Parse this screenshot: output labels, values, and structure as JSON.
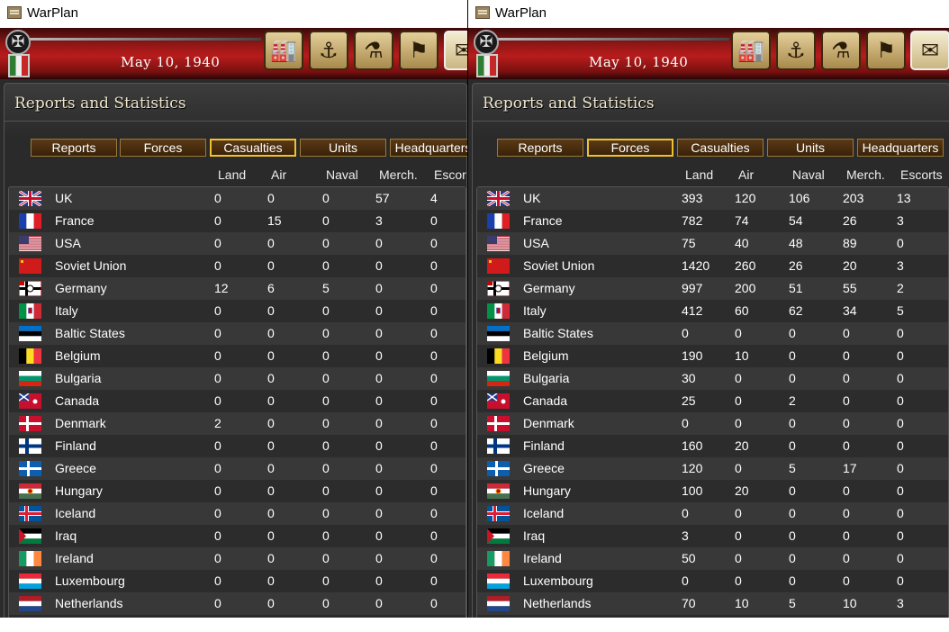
{
  "app": {
    "title": "WarPlan",
    "date": "May 10, 1940",
    "panel_title": "Reports and Statistics"
  },
  "toolbar": {
    "buttons": [
      "production-icon",
      "naval-icon",
      "research-icon",
      "flag-icon",
      "reports-icon"
    ]
  },
  "tabs": [
    "Reports",
    "Forces",
    "Casualties",
    "Units",
    "Headquarters"
  ],
  "columns": [
    "Land",
    "Air",
    "Naval",
    "Merch.",
    "Escorts"
  ],
  "columns_left": [
    "Land",
    "Air",
    "Naval",
    "Merch.",
    "Escor"
  ],
  "countries": [
    {
      "name": "UK",
      "flag": "uk"
    },
    {
      "name": "France",
      "flag": "france"
    },
    {
      "name": "USA",
      "flag": "usa"
    },
    {
      "name": "Soviet Union",
      "flag": "soviet"
    },
    {
      "name": "Germany",
      "flag": "germany"
    },
    {
      "name": "Italy",
      "flag": "italy"
    },
    {
      "name": "Baltic States",
      "flag": "baltic"
    },
    {
      "name": "Belgium",
      "flag": "belgium"
    },
    {
      "name": "Bulgaria",
      "flag": "bulgaria"
    },
    {
      "name": "Canada",
      "flag": "canada"
    },
    {
      "name": "Denmark",
      "flag": "denmark"
    },
    {
      "name": "Finland",
      "flag": "finland"
    },
    {
      "name": "Greece",
      "flag": "greece"
    },
    {
      "name": "Hungary",
      "flag": "hungary"
    },
    {
      "name": "Iceland",
      "flag": "iceland"
    },
    {
      "name": "Iraq",
      "flag": "iraq"
    },
    {
      "name": "Ireland",
      "flag": "ireland"
    },
    {
      "name": "Luxembourg",
      "flag": "luxembourg"
    },
    {
      "name": "Netherlands",
      "flag": "netherlands"
    }
  ],
  "left": {
    "active_tab": "Casualties",
    "rows": [
      [
        "0",
        "0",
        "0",
        "57",
        "4"
      ],
      [
        "0",
        "15",
        "0",
        "3",
        "0"
      ],
      [
        "0",
        "0",
        "0",
        "0",
        "0"
      ],
      [
        "0",
        "0",
        "0",
        "0",
        "0"
      ],
      [
        "12",
        "6",
        "5",
        "0",
        "0"
      ],
      [
        "0",
        "0",
        "0",
        "0",
        "0"
      ],
      [
        "0",
        "0",
        "0",
        "0",
        "0"
      ],
      [
        "0",
        "0",
        "0",
        "0",
        "0"
      ],
      [
        "0",
        "0",
        "0",
        "0",
        "0"
      ],
      [
        "0",
        "0",
        "0",
        "0",
        "0"
      ],
      [
        "2",
        "0",
        "0",
        "0",
        "0"
      ],
      [
        "0",
        "0",
        "0",
        "0",
        "0"
      ],
      [
        "0",
        "0",
        "0",
        "0",
        "0"
      ],
      [
        "0",
        "0",
        "0",
        "0",
        "0"
      ],
      [
        "0",
        "0",
        "0",
        "0",
        "0"
      ],
      [
        "0",
        "0",
        "0",
        "0",
        "0"
      ],
      [
        "0",
        "0",
        "0",
        "0",
        "0"
      ],
      [
        "0",
        "0",
        "0",
        "0",
        "0"
      ],
      [
        "0",
        "0",
        "0",
        "0",
        "0"
      ]
    ]
  },
  "right": {
    "active_tab": "Forces",
    "rows": [
      [
        "393",
        "120",
        "106",
        "203",
        "13"
      ],
      [
        "782",
        "74",
        "54",
        "26",
        "3"
      ],
      [
        "75",
        "40",
        "48",
        "89",
        "0"
      ],
      [
        "1420",
        "260",
        "26",
        "20",
        "3"
      ],
      [
        "997",
        "200",
        "51",
        "55",
        "2"
      ],
      [
        "412",
        "60",
        "62",
        "34",
        "5"
      ],
      [
        "0",
        "0",
        "0",
        "0",
        "0"
      ],
      [
        "190",
        "10",
        "0",
        "0",
        "0"
      ],
      [
        "30",
        "0",
        "0",
        "0",
        "0"
      ],
      [
        "25",
        "0",
        "2",
        "0",
        "0"
      ],
      [
        "0",
        "0",
        "0",
        "0",
        "0"
      ],
      [
        "160",
        "20",
        "0",
        "0",
        "0"
      ],
      [
        "120",
        "0",
        "5",
        "17",
        "0"
      ],
      [
        "100",
        "20",
        "0",
        "0",
        "0"
      ],
      [
        "0",
        "0",
        "0",
        "0",
        "0"
      ],
      [
        "3",
        "0",
        "0",
        "0",
        "0"
      ],
      [
        "50",
        "0",
        "0",
        "0",
        "0"
      ],
      [
        "0",
        "0",
        "0",
        "0",
        "0"
      ],
      [
        "70",
        "10",
        "5",
        "10",
        "3"
      ]
    ]
  }
}
